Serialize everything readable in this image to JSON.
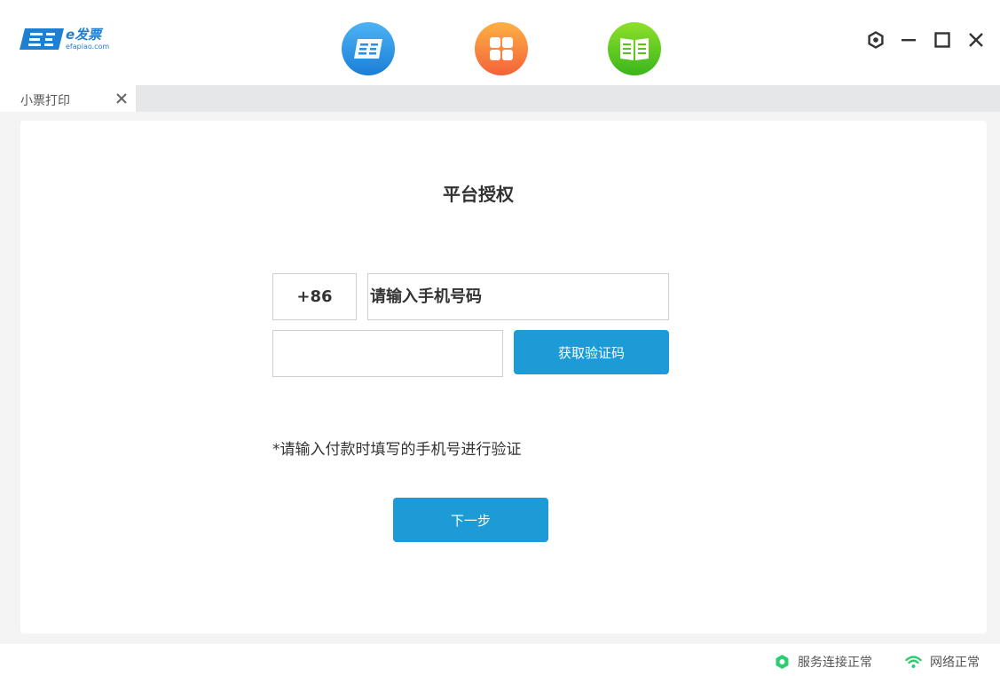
{
  "logo": {
    "brand": "e发票",
    "domain": "efapiao.com"
  },
  "header": {
    "apps": [
      {
        "icon": "invoice-app-icon",
        "color": "#2a8fe2"
      },
      {
        "icon": "grid-app-icon",
        "color": "#f77a3a"
      },
      {
        "icon": "book-app-icon",
        "color": "#57c21d"
      }
    ],
    "window_controls": [
      "settings-icon",
      "minimize-icon",
      "maximize-icon",
      "close-icon"
    ]
  },
  "tabs": [
    {
      "label": "小票打印"
    }
  ],
  "form": {
    "title": "平台授权",
    "country_code": "+86",
    "phone_placeholder": "请输入手机号码",
    "code_value": "",
    "get_code_label": "获取验证码",
    "hint": "*请输入付款时填写的手机号进行验证",
    "next_label": "下一步"
  },
  "status": {
    "service": "服务连接正常",
    "network": "网络正常"
  },
  "colors": {
    "accent": "#1c9bd7",
    "logo_blue": "#1f7fd1",
    "ok_green": "#2ecc71"
  }
}
